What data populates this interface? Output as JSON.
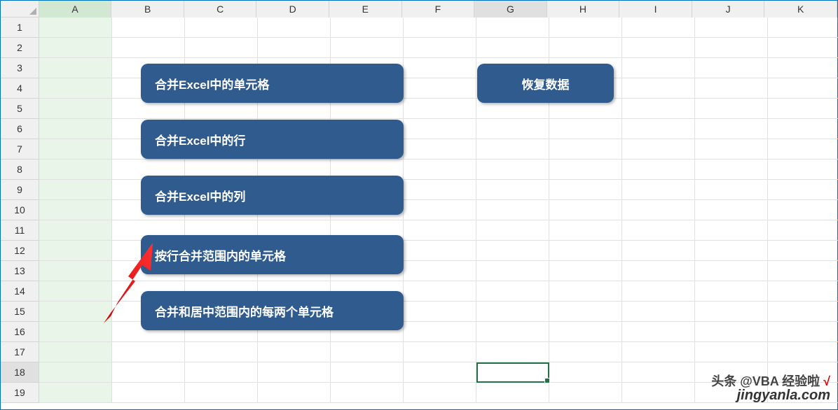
{
  "columns": [
    "A",
    "B",
    "C",
    "D",
    "E",
    "F",
    "G",
    "H",
    "I",
    "J",
    "K"
  ],
  "rows": [
    "1",
    "2",
    "3",
    "4",
    "5",
    "6",
    "7",
    "8",
    "9",
    "10",
    "11",
    "12",
    "13",
    "14",
    "15",
    "16",
    "17",
    "18",
    "19"
  ],
  "selectedColumn": "A",
  "activeCell": {
    "col": "G",
    "row": "18"
  },
  "buttons": {
    "b1": "合并Excel中的单元格",
    "b2": "合并Excel中的行",
    "b3": "合并Excel中的列",
    "b4": "按行合并范围内的单元格",
    "b5": "合并和居中范围内的每两个单元格",
    "restore": "恢复数据"
  },
  "watermark_top": "头条 @VBA 经验啦",
  "watermark_bottom": "jingyanla.com",
  "check": "√"
}
